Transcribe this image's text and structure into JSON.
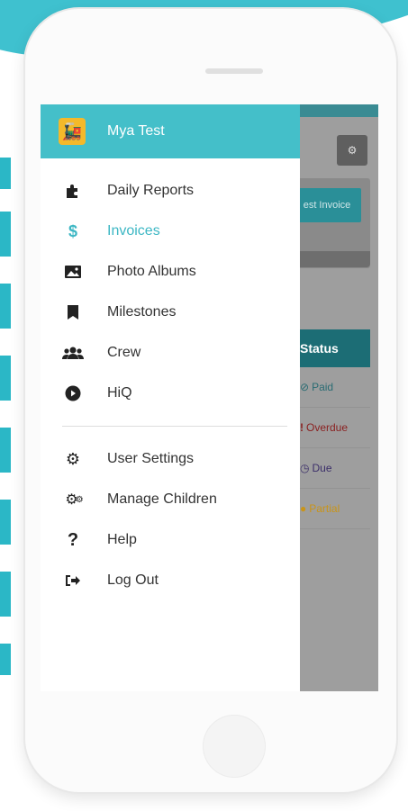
{
  "drawer": {
    "user_name": "Mya Test",
    "main_items": [
      {
        "label": "Daily Reports",
        "icon": "puzzle-icon"
      },
      {
        "label": "Invoices",
        "icon": "dollar-icon",
        "active": true
      },
      {
        "label": "Photo Albums",
        "icon": "image-icon"
      },
      {
        "label": "Milestones",
        "icon": "bookmark-icon"
      },
      {
        "label": "Crew",
        "icon": "users-icon"
      },
      {
        "label": "HiQ",
        "icon": "play-circle-icon"
      }
    ],
    "settings_items": [
      {
        "label": "User Settings",
        "icon": "gear-icon"
      },
      {
        "label": "Manage Children",
        "icon": "gears-icon"
      },
      {
        "label": "Help",
        "icon": "question-icon"
      },
      {
        "label": "Log Out",
        "icon": "logout-icon"
      }
    ]
  },
  "background_app": {
    "request_button": "est Invoice",
    "table_header": "Status",
    "rows": [
      {
        "status": "Paid",
        "color": "#2a6c73",
        "icon": "check-circle-icon"
      },
      {
        "status": "Overdue",
        "color": "#8a1f1f",
        "icon": "exclamation-icon"
      },
      {
        "status": "Due",
        "color": "#3c2f6a",
        "icon": "clock-icon"
      },
      {
        "status": "Partial",
        "color": "#c99418",
        "icon": "circle-icon"
      }
    ]
  },
  "colors": {
    "accent": "#44bfc9",
    "active": "#3db7c4"
  }
}
